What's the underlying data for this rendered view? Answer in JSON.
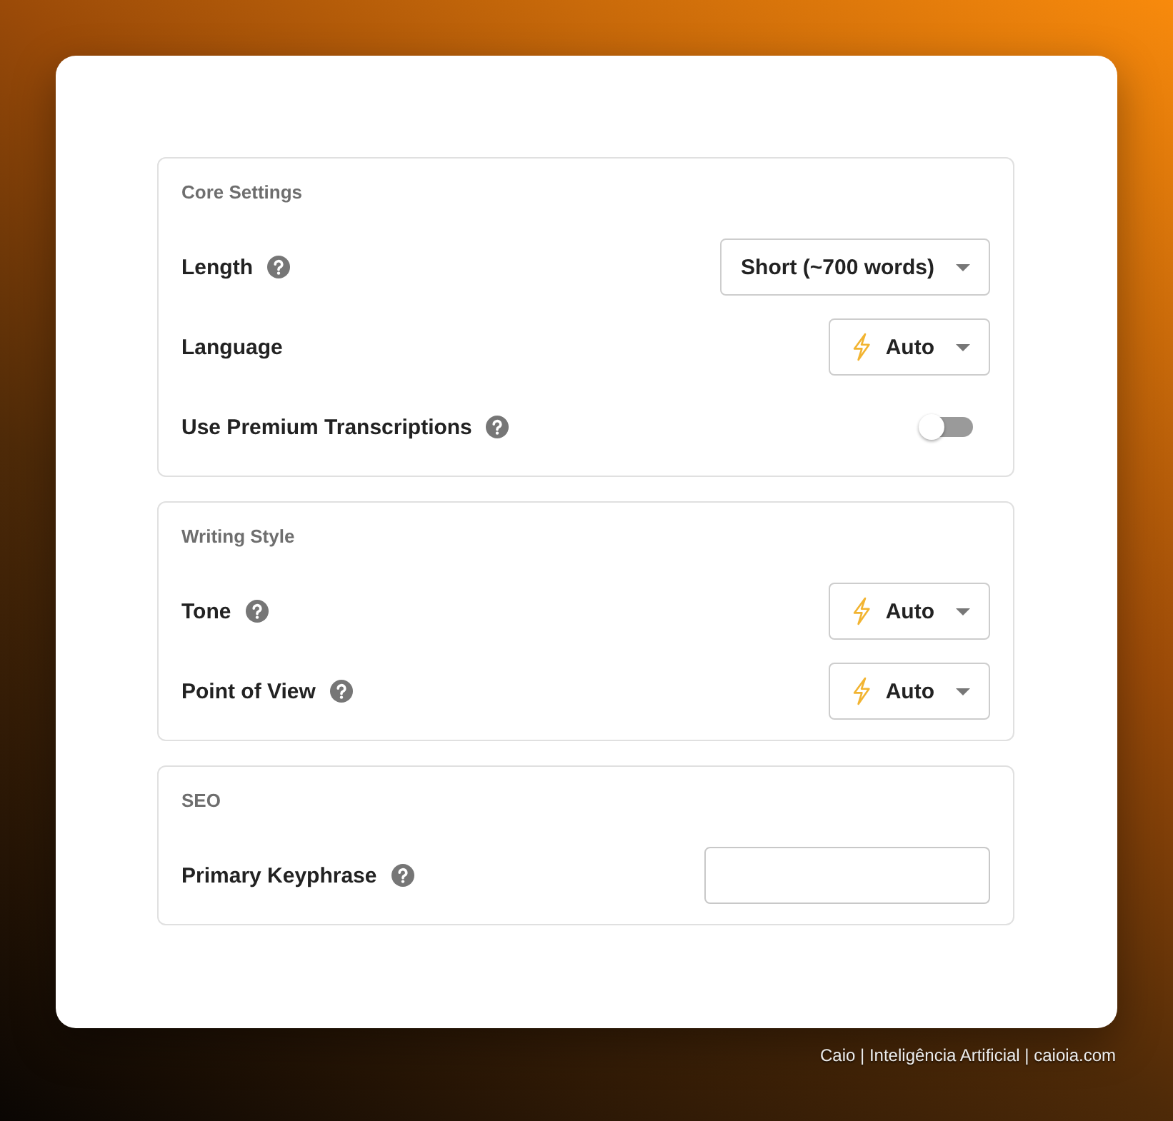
{
  "sections": [
    {
      "title": "Core Settings",
      "rows": [
        {
          "kind": "select",
          "label": "Length",
          "help": true,
          "select": {
            "value": "Short (~700 words)",
            "leading_icon": false
          }
        },
        {
          "kind": "select",
          "label": "Language",
          "help": false,
          "select": {
            "value": "Auto",
            "leading_icon": true
          }
        },
        {
          "kind": "toggle",
          "label": "Use Premium Transcriptions",
          "help": true,
          "on": false
        }
      ]
    },
    {
      "title": "Writing Style",
      "rows": [
        {
          "kind": "select",
          "label": "Tone",
          "help": true,
          "select": {
            "value": "Auto",
            "leading_icon": true
          }
        },
        {
          "kind": "select",
          "label": "Point of View",
          "help": true,
          "select": {
            "value": "Auto",
            "leading_icon": true
          }
        }
      ]
    },
    {
      "title": "SEO",
      "rows": [
        {
          "kind": "text",
          "label": "Primary Keyphrase",
          "help": true
        }
      ]
    }
  ],
  "credit": "Caio | Inteligência Artificial | caioia.com"
}
